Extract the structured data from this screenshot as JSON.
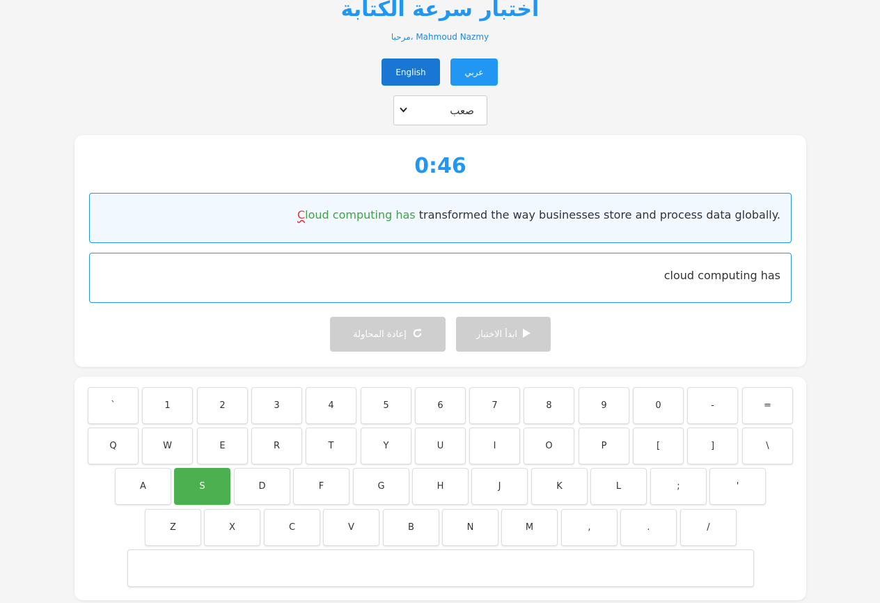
{
  "header": {
    "title": "اختبار سرعة الكتابة",
    "greeting": "مرحبا، Mahmoud Nazmy"
  },
  "language": {
    "english_label": "English",
    "arabic_label": "عربي"
  },
  "difficulty": {
    "selected": "صعب"
  },
  "test": {
    "timer": "0:46",
    "sample_correct": "Cloud computing has",
    "sample_rest": " transformed the way businesses store and process data globally.",
    "typed": "cloud computing has"
  },
  "actions": {
    "retry_label": "إعادة المحاولة",
    "start_label": "ابدأ الاختبار"
  },
  "keyboard": {
    "active_key": "S",
    "rows": [
      [
        "`",
        "1",
        "2",
        "3",
        "4",
        "5",
        "6",
        "7",
        "8",
        "9",
        "0",
        "-",
        "="
      ],
      [
        "Q",
        "W",
        "E",
        "R",
        "T",
        "Y",
        "U",
        "I",
        "O",
        "P",
        "[",
        "]",
        "\\"
      ],
      [
        "A",
        "S",
        "D",
        "F",
        "G",
        "H",
        "J",
        "K",
        "L",
        ";",
        "'"
      ],
      [
        "Z",
        "X",
        "C",
        "V",
        "B",
        "N",
        "M",
        ",",
        ".",
        "/"
      ]
    ],
    "space_label": ""
  },
  "colors": {
    "accent": "#2196f3",
    "accent_dark": "#1976d2",
    "correct": "#43a047",
    "error": "#e53935",
    "disabled": "#cfcfcf",
    "key_active": "#4caf50"
  },
  "icons": {
    "retry": "redo-icon",
    "start": "play-icon",
    "select": "chevron-down-icon"
  }
}
